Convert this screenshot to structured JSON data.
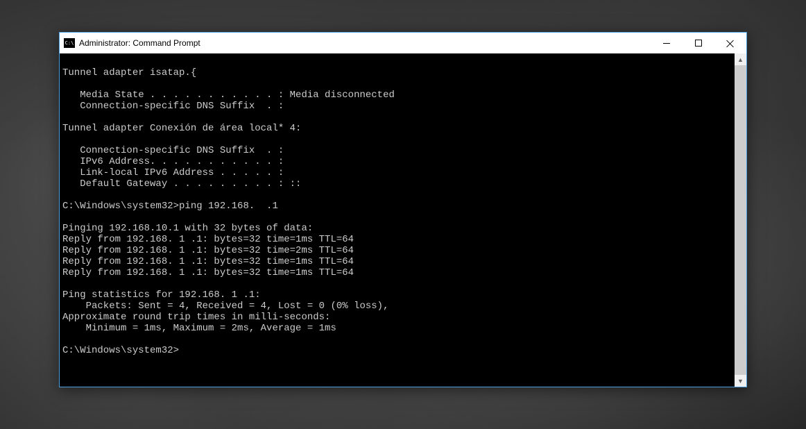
{
  "window": {
    "title": "Administrator: Command Prompt"
  },
  "terminal": {
    "lines": [
      "",
      "Tunnel adapter isatap.{",
      "",
      "   Media State . . . . . . . . . . . : Media disconnected",
      "   Connection-specific DNS Suffix  . :",
      "",
      "Tunnel adapter Conexión de área local* 4:",
      "",
      "   Connection-specific DNS Suffix  . :",
      "   IPv6 Address. . . . . . . . . . . :",
      "   Link-local IPv6 Address . . . . . :",
      "   Default Gateway . . . . . . . . . : ::",
      "",
      "C:\\Windows\\system32>ping 192.168.  .1",
      "",
      "Pinging 192.168.10.1 with 32 bytes of data:",
      "Reply from 192.168. 1 .1: bytes=32 time=1ms TTL=64",
      "Reply from 192.168. 1 .1: bytes=32 time=2ms TTL=64",
      "Reply from 192.168. 1 .1: bytes=32 time=1ms TTL=64",
      "Reply from 192.168. 1 .1: bytes=32 time=1ms TTL=64",
      "",
      "Ping statistics for 192.168. 1 .1:",
      "    Packets: Sent = 4, Received = 4, Lost = 0 (0% loss),",
      "Approximate round trip times in milli-seconds:",
      "    Minimum = 1ms, Maximum = 2ms, Average = 1ms",
      "",
      "C:\\Windows\\system32>"
    ]
  }
}
